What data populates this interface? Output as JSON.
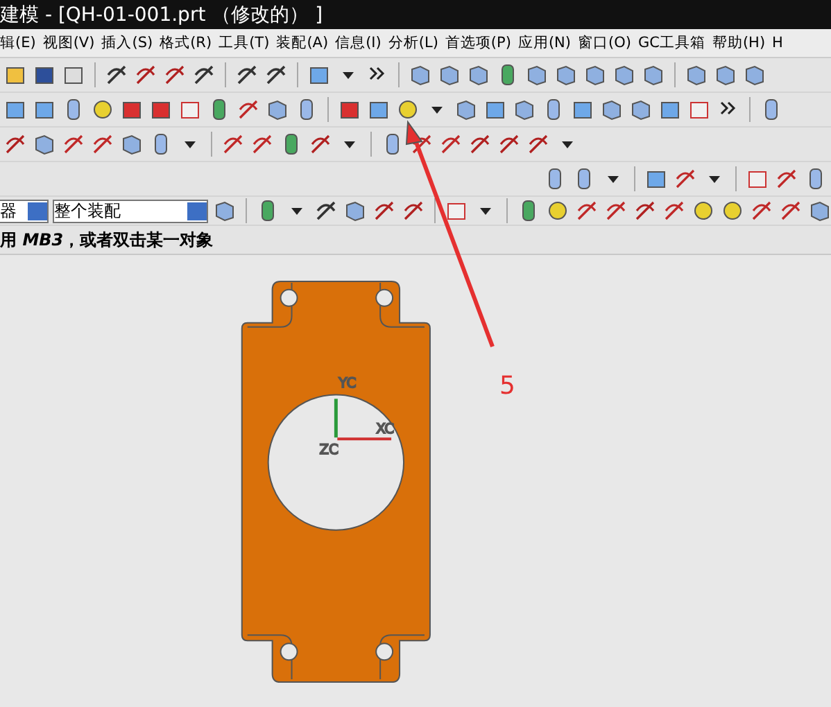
{
  "window": {
    "title": "建模 - [QH-01-001.prt （修改的） ]"
  },
  "menu": [
    "辑(E)",
    "视图(V)",
    "插入(S)",
    "格式(R)",
    "工具(T)",
    "装配(A)",
    "信息(I)",
    "分析(L)",
    "首选项(P)",
    "应用(N)",
    "窗口(O)",
    "GC工具箱",
    "帮助(H)",
    "H"
  ],
  "selection_bar": {
    "filter": "器",
    "scope": "整个装配"
  },
  "status_bar": "用 *MB3*，或者双击某一对象",
  "viewport": {
    "axes": [
      "YC",
      "XC",
      "ZC"
    ],
    "callout": "5"
  }
}
